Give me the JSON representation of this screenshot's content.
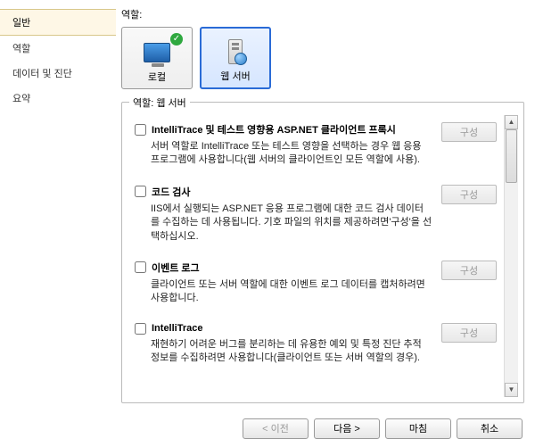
{
  "sidebar": {
    "items": [
      {
        "label": "일반",
        "selected": true
      },
      {
        "label": "역할",
        "selected": false
      },
      {
        "label": "데이터 및 진단",
        "selected": false
      },
      {
        "label": "요약",
        "selected": false
      }
    ]
  },
  "roles": {
    "header": "역할:",
    "tiles": [
      {
        "label": "로컬",
        "icon": "monitor",
        "checked": true,
        "selected": false
      },
      {
        "label": "웹 서버",
        "icon": "server",
        "checked": false,
        "selected": true
      }
    ]
  },
  "group": {
    "title": "역할: 웹 서버",
    "configure_label": "구성",
    "items": [
      {
        "title": "IntelliTrace 및 테스트 영향용 ASP.NET 클라이언트 프록시",
        "desc": "서버 역할로 IntelliTrace 또는 테스트 영향을 선택하는 경우 웹 응용 프로그램에 사용합니다(웹 서버의 클라이언트인 모든 역할에 사용).",
        "checked": false
      },
      {
        "title": "코드 검사",
        "desc": "IIS에서 실행되는 ASP.NET 응용 프로그램에 대한 코드 검사 데이터를 수집하는 데 사용됩니다. 기호 파일의 위치를 제공하려면'구성'을 선택하십시오.",
        "checked": false
      },
      {
        "title": "이벤트 로그",
        "desc": "클라이언트 또는 서버 역할에 대한 이벤트 로그 데이터를 캡처하려면 사용합니다.",
        "checked": false
      },
      {
        "title": "IntelliTrace",
        "desc": "재현하기 어려운 버그를 분리하는 데 유용한 예외 및 특정 진단 추적 정보를 수집하려면 사용합니다(클라이언트 또는 서버 역할의 경우).",
        "checked": false
      }
    ]
  },
  "footer": {
    "prev": "< 이전",
    "next": "다음 >",
    "finish": "마침",
    "cancel": "취소"
  }
}
